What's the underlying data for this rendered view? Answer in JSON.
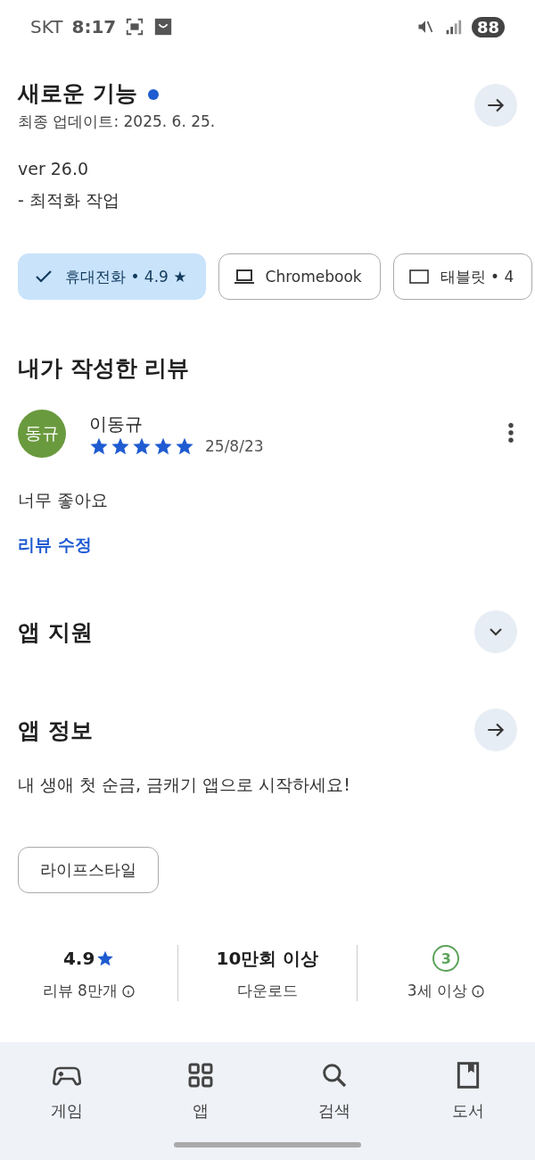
{
  "status_bar": {
    "carrier": "SKT",
    "time": "8:17",
    "battery": "88"
  },
  "whats_new": {
    "title": "새로운 기능",
    "updated": "최종 업데이트: 2025. 6. 25.",
    "lines": [
      "ver 26.0",
      "- 최적화 작업"
    ]
  },
  "device_chips": [
    {
      "kind": "phone",
      "label": "휴대전화 • 4.9 ★",
      "selected": true
    },
    {
      "kind": "laptop",
      "label": "Chromebook",
      "selected": false
    },
    {
      "kind": "tablet",
      "label": "태블릿 • 4",
      "selected": false
    }
  ],
  "my_review": {
    "heading": "내가 작성한 리뷰",
    "avatar": "동규",
    "name": "이동규",
    "stars": 5,
    "date": "25/8/23",
    "text": "너무 좋아요",
    "edit_link": "리뷰 수정"
  },
  "app_support": {
    "title": "앱 지원",
    "expanded": false
  },
  "app_info": {
    "title": "앱 정보",
    "description": "내 생애 첫 순금, 금캐기 앱으로 시작하세요!",
    "category": "라이프스타일"
  },
  "stats": [
    {
      "kind": "rating",
      "value": "4.9",
      "label": "리뷰 8만개"
    },
    {
      "kind": "text",
      "value": "10만회 이상",
      "label": "다운로드"
    },
    {
      "kind": "age",
      "value": "3",
      "label": "3세 이상"
    }
  ],
  "bottom_nav": [
    {
      "kind": "games",
      "label": "게임"
    },
    {
      "kind": "apps",
      "label": "앱"
    },
    {
      "kind": "search",
      "label": "검색"
    },
    {
      "kind": "books",
      "label": "도서"
    }
  ]
}
